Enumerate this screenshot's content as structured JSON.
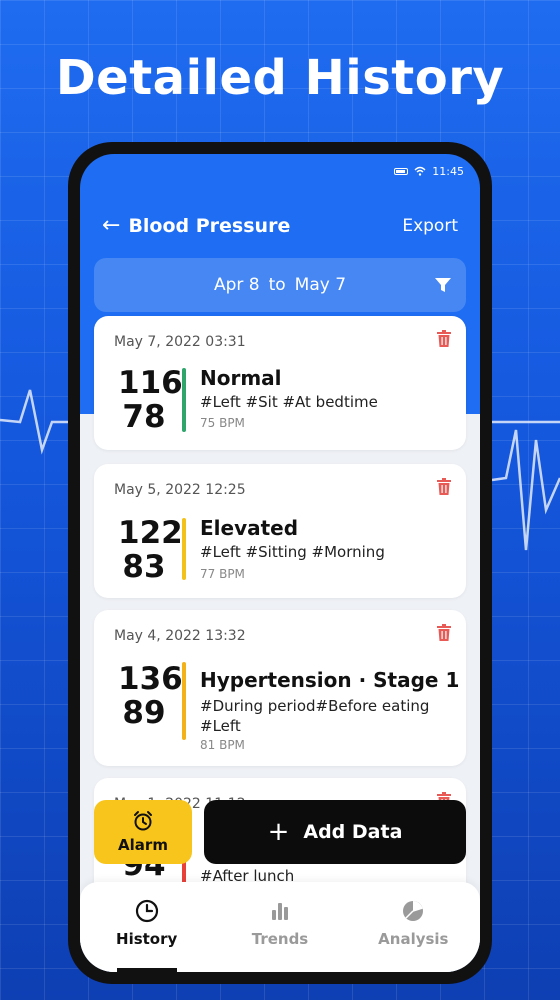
{
  "headline": "Detailed History",
  "status_bar": {
    "time": "11:45"
  },
  "header": {
    "title": "Blood Pressure",
    "export_label": "Export"
  },
  "date_range": {
    "from": "Apr 8",
    "sep": "to",
    "to": "May 7"
  },
  "records": [
    {
      "date": "May 7, 2022 03:31",
      "systolic": "116",
      "diastolic": "78",
      "status": "Normal",
      "tags": "#Left #Sit #At bedtime",
      "bpm": "75 BPM",
      "bar_color": "#2fa56b"
    },
    {
      "date": "May 5, 2022 12:25",
      "systolic": "122",
      "diastolic": "83",
      "status": "Elevated",
      "tags": "#Left #Sitting #Morning",
      "bpm": "77 BPM",
      "bar_color": "#f3c21a"
    },
    {
      "date": "May 4, 2022 13:32",
      "systolic": "136",
      "diastolic": "89",
      "status": "Hypertension · Stage 1",
      "tags": "#During period#Before eating #Left",
      "bpm": "81 BPM",
      "bar_color": "#f3b21a"
    },
    {
      "date": "May 1, 2022 11:12",
      "systolic": "",
      "diastolic": "94",
      "status": "",
      "tags": "#After lunch",
      "bpm": "",
      "bar_color": "#e8413a"
    }
  ],
  "alarm": {
    "label": "Alarm",
    "icon": "alarm-clock-icon"
  },
  "add_button": {
    "label": "Add Data"
  },
  "nav": [
    {
      "label": "History",
      "icon": "clock-icon"
    },
    {
      "label": "Trends",
      "icon": "bar-chart-icon"
    },
    {
      "label": "Analysis",
      "icon": "pie-chart-icon"
    }
  ],
  "colors": {
    "primary": "#1e6df2",
    "alarm": "#f7c51b",
    "delete": "#e85a55"
  }
}
